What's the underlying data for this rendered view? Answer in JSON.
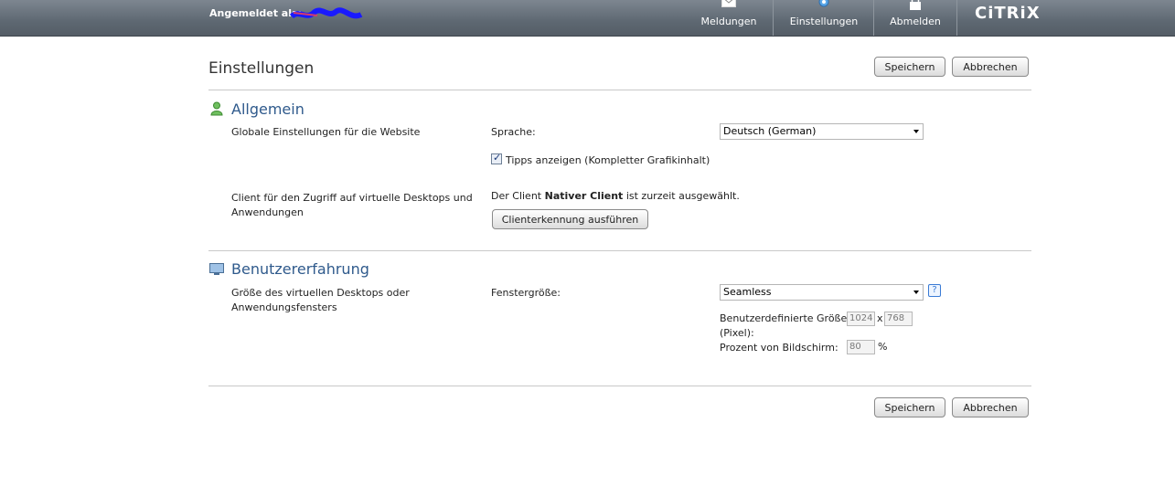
{
  "header": {
    "logged_in_label": "Angemeldet als:",
    "nav": [
      {
        "label": "Meldungen",
        "icon": "envelope-icon"
      },
      {
        "label": "Einstellungen",
        "icon": "gear-icon"
      },
      {
        "label": "Abmelden",
        "icon": "lock-icon"
      }
    ],
    "brand": "CiTRiX"
  },
  "page": {
    "title": "Einstellungen",
    "save_label": "Speichern",
    "cancel_label": "Abbrechen"
  },
  "general": {
    "title": "Allgemein",
    "website_label": "Globale Einstellungen für die Website",
    "language_label": "Sprache:",
    "language_value": "Deutsch (German)",
    "tips_label": "Tipps anzeigen (Kompletter Grafikinhalt)",
    "tips_checked": true,
    "client_label_line1": "Client für den Zugriff auf virtuelle Desktops und",
    "client_label_line2": "Anwendungen",
    "client_status_pre": "Der Client ",
    "client_status_name": "Nativer Client",
    "client_status_post": " ist zurzeit ausgewählt.",
    "detect_button": "Clienterkennung ausführen"
  },
  "experience": {
    "title": "Benutzererfahrung",
    "size_label_line1": "Größe des virtuellen Desktops oder",
    "size_label_line2": "Anwendungsfensters",
    "window_size_label": "Fenstergröße:",
    "window_size_value": "Seamless",
    "help_glyph": "?",
    "custom_size_label_line1": "Benutzerdefinierte Größe",
    "custom_size_label_line2": "(Pixel):",
    "width_value": "1024",
    "times": "x",
    "height_value": "768",
    "percent_label": "Prozent von Bildschirm:",
    "percent_value": "80",
    "percent_sign": "%"
  },
  "colors": {
    "topbar": "#5e6872",
    "section_title": "#2f5a8c"
  }
}
